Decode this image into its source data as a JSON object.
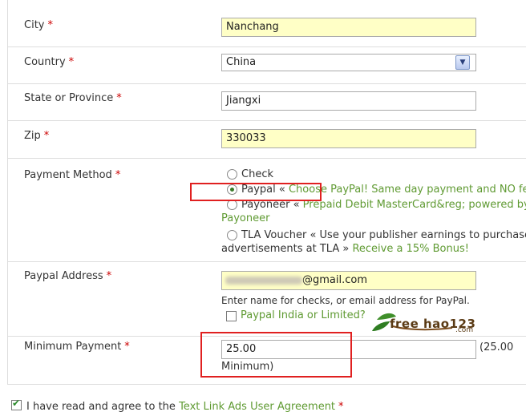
{
  "fields": {
    "city": {
      "label": "City",
      "value": "Nanchang"
    },
    "country": {
      "label": "Country",
      "value": "China"
    },
    "state": {
      "label": "State or Province",
      "value": "Jiangxi"
    },
    "zip": {
      "label": "Zip",
      "value": "330033"
    },
    "payment_method": {
      "label": "Payment Method",
      "options": [
        {
          "label": "Check",
          "extra": "",
          "selected": false
        },
        {
          "label": "Paypal",
          "extra_pre": " « ",
          "extra": "Choose PayPal! Same day payment and NO fees!",
          "selected": true
        },
        {
          "label": "Payoneer",
          "extra_pre": " « ",
          "extra": "Prepaid Debit MasterCard&reg; powered by",
          "extra2": "Payoneer",
          "selected": false
        },
        {
          "label": "TLA Voucher",
          "extra_pre": " « Use your publisher earnings to purchase",
          "extra_line2": "advertisements at TLA » ",
          "extra": "Receive a 15% Bonus!",
          "selected": false
        }
      ]
    },
    "paypal_address": {
      "label": "Paypal Address",
      "value": "@gmail.com",
      "help": "Enter name for checks, or email address for PayPal.",
      "india_label": "Paypal India or Limited?"
    },
    "minimum_payment": {
      "label": "Minimum Payment",
      "value": "25.00",
      "hint_1": "(25.00",
      "hint_2": "Minimum)"
    }
  },
  "required_mark": "*",
  "agreement": {
    "prefix": "I have read and agree to the ",
    "link": "Text Link Ads User Agreement",
    "checked": true
  },
  "watermark": {
    "text": "free hao123",
    "suffix": ".com"
  },
  "colors": {
    "required": "#cc0000",
    "link_green": "#5f9a32",
    "highlight_box": "#e02020",
    "input_yellow": "#ffffc6"
  }
}
